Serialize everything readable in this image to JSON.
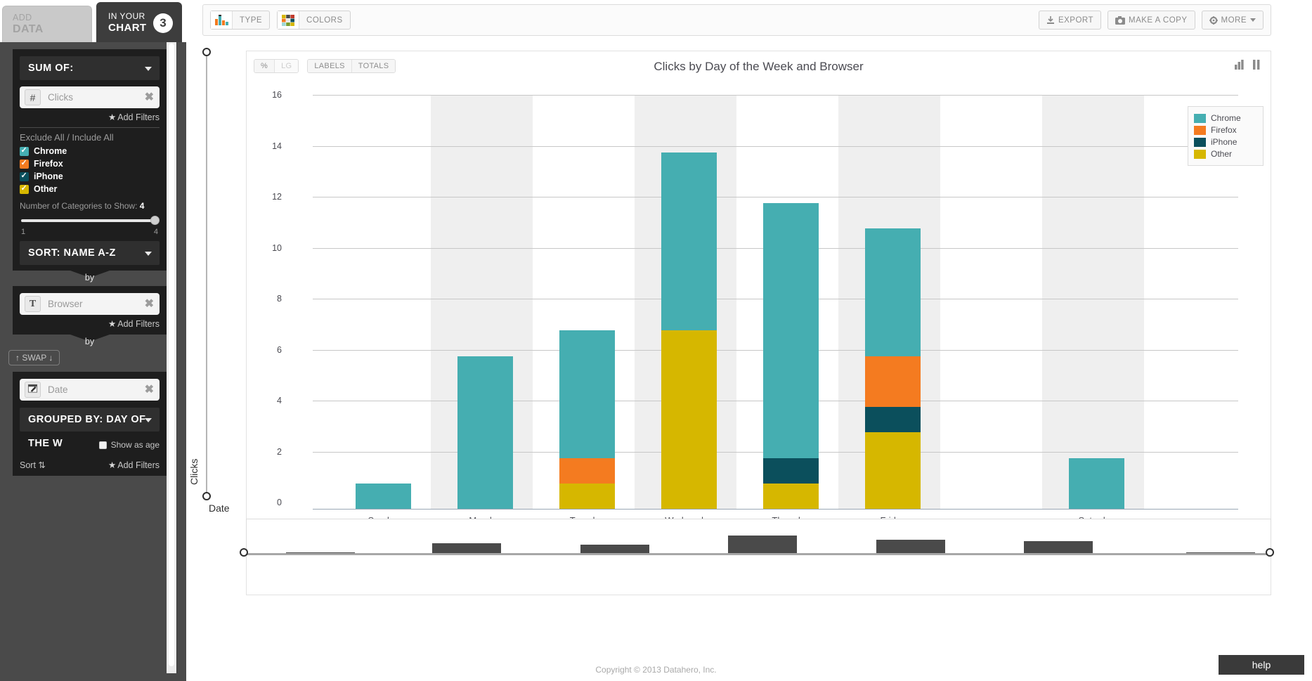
{
  "tabs": {
    "add_data_line1": "ADD",
    "add_data_line2": "DATA",
    "in_chart_line1": "IN YOUR",
    "in_chart_line2": "CHART",
    "in_chart_badge": "3"
  },
  "sidebar": {
    "sum_of_label": "SUM OF:",
    "metric_field": {
      "icon": "hash-icon",
      "icon_glyph": "#",
      "label": "Clicks",
      "remove": "✖"
    },
    "add_filters_1": "Add Filters",
    "exclude_include": "Exclude All / Include All",
    "categories": [
      {
        "label": "Chrome",
        "color": "#45aeb1",
        "checked": true
      },
      {
        "label": "Firefox",
        "color": "#f47b20",
        "checked": true
      },
      {
        "label": "iPhone",
        "color": "#0b4f5c",
        "checked": true
      },
      {
        "label": "Other",
        "color": "#d6b700",
        "checked": true
      }
    ],
    "num_categories_label": "Number of Categories to Show:",
    "num_categories_value": "4",
    "slider_min": "1",
    "slider_max": "4",
    "sort_label": "SORT:  NAME A-Z",
    "by_label_1": "by",
    "group_field": {
      "icon": "text-icon",
      "icon_glyph": "T",
      "label": "Browser",
      "remove": "✖"
    },
    "add_filters_2": "Add Filters",
    "by_label_2": "by",
    "swap_label": "SWAP",
    "swap_up": "↑",
    "swap_down": "↓",
    "date_field": {
      "icon": "calendar-icon",
      "label": "Date",
      "remove": "✖"
    },
    "grouped_by_label": "GROUPED BY:  DAY OF THE W",
    "show_as_age": "Show as age",
    "sort_toggle": "Sort",
    "add_filters_3": "Add Filters"
  },
  "toolbar": {
    "type_label": "TYPE",
    "colors_label": "COLORS",
    "export_label": "EXPORT",
    "export_icon": "download-icon",
    "make_copy_label": "MAKE A COPY",
    "make_copy_icon": "camera-icon",
    "more_label": "MORE",
    "more_icon": "gear-icon"
  },
  "chart_toggles": {
    "percent": "%",
    "log": "LG",
    "labels": "LABELS",
    "totals": "TOTALS"
  },
  "chart_data": {
    "type": "bar",
    "stacked": true,
    "title": "Clicks by Day of the Week and Browser",
    "xlabel": "Date",
    "ylabel": "Clicks",
    "ylim": [
      0,
      16
    ],
    "yticks": [
      0,
      2,
      4,
      6,
      8,
      10,
      12,
      14,
      16
    ],
    "grid": true,
    "legend_position": "top-right",
    "categories": [
      "Sunday",
      "Monday",
      "Tuesday",
      "Wednesday",
      "Thursday",
      "Friday",
      "Saturday"
    ],
    "series": [
      {
        "name": "Other",
        "color": "#d6b700",
        "values": [
          0,
          0,
          1,
          7,
          1,
          3,
          0
        ]
      },
      {
        "name": "iPhone",
        "color": "#0b4f5c",
        "values": [
          0,
          0,
          0,
          0,
          1,
          1,
          0
        ]
      },
      {
        "name": "Firefox",
        "color": "#f47b20",
        "values": [
          0,
          0,
          1,
          0,
          0,
          2,
          0
        ]
      },
      {
        "name": "Chrome",
        "color": "#45aeb1",
        "values": [
          1,
          6,
          5,
          7,
          10,
          5,
          2
        ]
      }
    ],
    "totals": [
      1,
      6,
      7,
      14,
      12,
      11,
      2
    ],
    "legend": [
      {
        "label": "Chrome",
        "color": "#45aeb1"
      },
      {
        "label": "Firefox",
        "color": "#f47b20"
      },
      {
        "label": "iPhone",
        "color": "#0b4f5c"
      },
      {
        "label": "Other",
        "color": "#d6b700"
      }
    ],
    "range_preview": [
      0.08,
      0.5,
      0.45,
      0.85,
      0.65,
      0.6,
      0.06
    ]
  },
  "footer": {
    "copyright": "Copyright © 2013 Datahero, Inc.",
    "help_label": "help"
  }
}
